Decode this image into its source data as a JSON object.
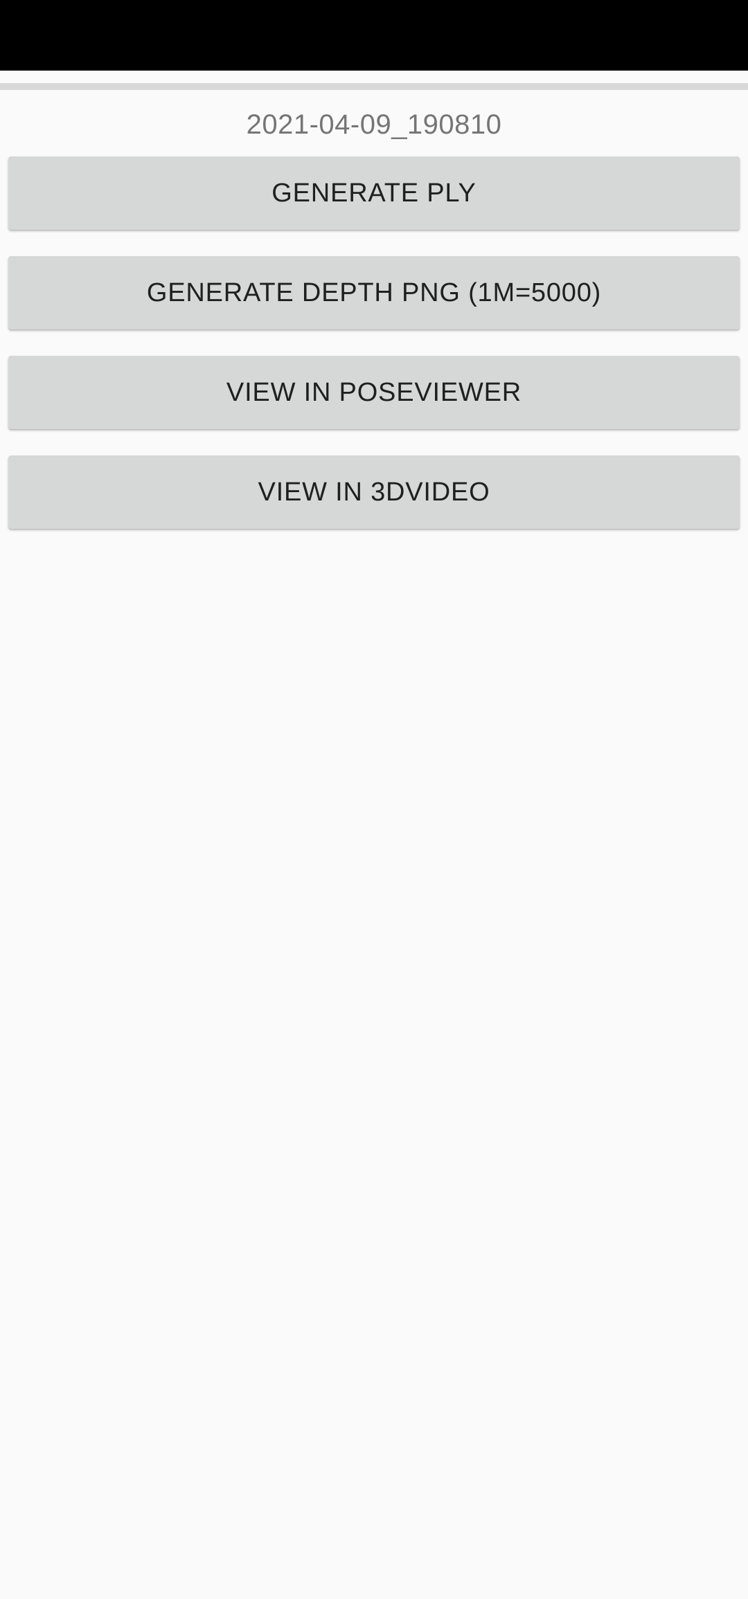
{
  "screen": {
    "timestamp": "2021-04-09_190810",
    "progress": 0
  },
  "buttons": {
    "generate_ply": "GENERATE PLY",
    "generate_depth_png": "GENERATE DEPTH PNG (1M=5000)",
    "view_in_poseviewer": "VIEW IN POSEVIEWER",
    "view_in_3dvideo": "VIEW IN 3DVIDEO"
  },
  "colors": {
    "status_bar": "#000000",
    "background": "#fafafa",
    "button_bg": "#d6d7d7",
    "button_text": "#1f1f1f",
    "timestamp_text": "#757575"
  }
}
